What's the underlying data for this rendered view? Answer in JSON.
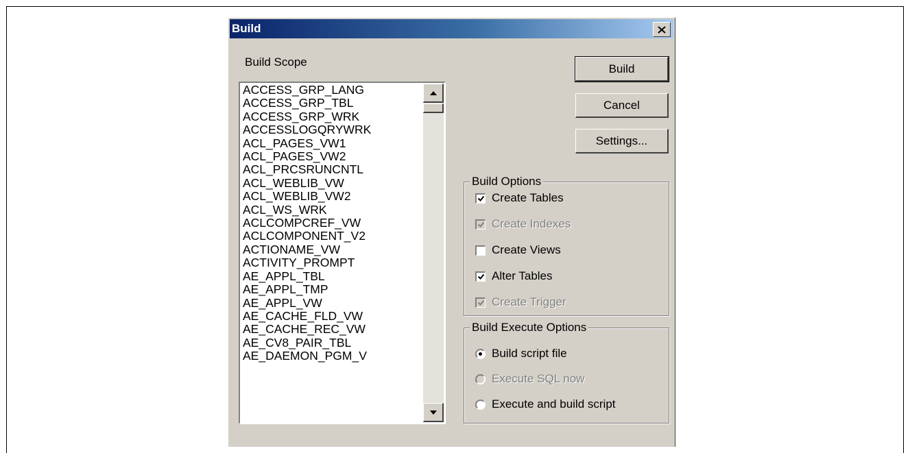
{
  "dialog": {
    "title": "Build"
  },
  "scope": {
    "label": "Build Scope",
    "items": [
      "ACCESS_GRP_LANG",
      "ACCESS_GRP_TBL",
      "ACCESS_GRP_WRK",
      "ACCESSLOGQRYWRK",
      "ACL_PAGES_VW1",
      "ACL_PAGES_VW2",
      "ACL_PRCSRUNCNTL",
      "ACL_WEBLIB_VW",
      "ACL_WEBLIB_VW2",
      "ACL_WS_WRK",
      "ACLCOMPCREF_VW",
      "ACLCOMPONENT_V2",
      "ACTIONAME_VW",
      "ACTIVITY_PROMPT",
      "AE_APPL_TBL",
      "AE_APPL_TMP",
      "AE_APPL_VW",
      "AE_CACHE_FLD_VW",
      "AE_CACHE_REC_VW",
      "AE_CV8_PAIR_TBL",
      "AE_DAEMON_PGM_V"
    ]
  },
  "buttons": {
    "build": "Build",
    "cancel": "Cancel",
    "settings": "Settings..."
  },
  "build_options": {
    "title": "Build Options",
    "items": [
      {
        "label": "Create Tables",
        "checked": true,
        "enabled": true
      },
      {
        "label": "Create Indexes",
        "checked": true,
        "enabled": false
      },
      {
        "label": "Create Views",
        "checked": false,
        "enabled": true
      },
      {
        "label": "Alter Tables",
        "checked": true,
        "enabled": true
      },
      {
        "label": "Create Trigger",
        "checked": true,
        "enabled": false
      }
    ]
  },
  "execute_options": {
    "title": "Build Execute Options",
    "items": [
      {
        "label": "Build script file",
        "selected": true,
        "enabled": true
      },
      {
        "label": "Execute SQL now",
        "selected": false,
        "enabled": false
      },
      {
        "label": "Execute and build script",
        "selected": false,
        "enabled": true
      }
    ]
  }
}
